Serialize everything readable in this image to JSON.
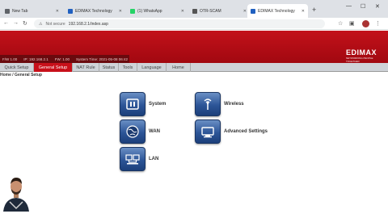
{
  "browser": {
    "tabs": [
      {
        "title": "New Tab",
        "fav_color": "#5f6368"
      },
      {
        "title": "EDIMAX Technology",
        "fav_color": "#2060c0"
      },
      {
        "title": "(1) WhatsApp",
        "fav_color": "#25d366"
      },
      {
        "title": "OTR-SCAM",
        "fav_color": "#555555"
      },
      {
        "title": "EDIMAX Technology",
        "fav_color": "#2060c0"
      }
    ],
    "active_tab": 4,
    "security_label": "Not secure",
    "url": "192.168.2.1/index.asp"
  },
  "router": {
    "brand": "EDIMAX",
    "tagline": "NETWORKING PEOPLE TOGETHER",
    "status": [
      "F/W 1.00",
      "IP: 192.168.2.1",
      "FW: 1.00",
      "System Time: 2021-05-08 06:42"
    ],
    "menu": [
      "Quick Setup",
      "General Setup",
      "NAT Rule",
      "Status",
      "Tools",
      "Language",
      "Home"
    ],
    "active_menu": 1,
    "breadcrumb": "Home / General Setup",
    "items": [
      {
        "label": "System",
        "icon": "system-icon"
      },
      {
        "label": "Wireless",
        "icon": "wireless-icon"
      },
      {
        "label": "WAN",
        "icon": "wan-globe-icon"
      },
      {
        "label": "Advanced Settings",
        "icon": "advanced-settings-icon"
      },
      {
        "label": "LAN",
        "icon": "lan-icon"
      }
    ]
  },
  "colors": {
    "accent": "#c3111a",
    "icon_blue": "#2c5597"
  }
}
